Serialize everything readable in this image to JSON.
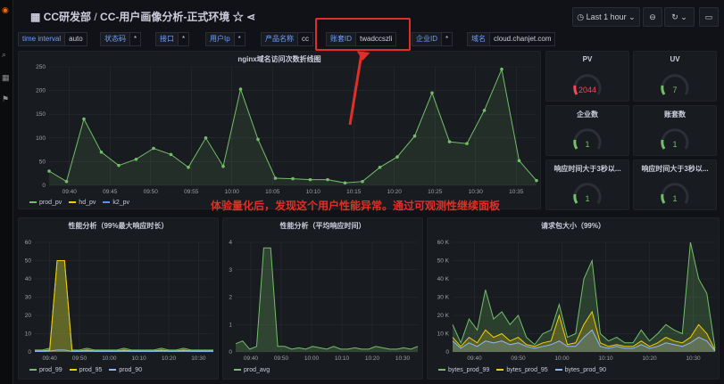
{
  "header": {
    "org": "CC研发部",
    "separator": " / ",
    "title": "CC-用户画像分析-正式环境",
    "star_icon": "star-icon",
    "share_icon": "share-icon",
    "time_range": "Last 1 hour"
  },
  "variables": [
    {
      "label": "time interval",
      "value": "auto"
    },
    {
      "label": "状态码",
      "value": "*"
    },
    {
      "label": "接口",
      "value": "*"
    },
    {
      "label": "用户Ip",
      "value": "*"
    },
    {
      "label": "产品名称",
      "value": "cc"
    },
    {
      "label": "账套ID",
      "value": "twadccszli"
    },
    {
      "label": "企业ID",
      "value": "*"
    },
    {
      "label": "域名",
      "value": "cloud.chanjet.com"
    }
  ],
  "annotation": "体验量化后，发现这个用户性能异常。通过可观测性继续面板",
  "colors": {
    "green": "#73bf69",
    "yellow": "#f2cc0c",
    "blue": "#5794f2",
    "cyan": "#8ab8ff",
    "red": "#f2495c",
    "accent": "#e02f27"
  },
  "stats": [
    {
      "title": "PV",
      "value": "2044",
      "color": "#f2495c"
    },
    {
      "title": "UV",
      "value": "7",
      "color": "#73bf69"
    },
    {
      "title": "企业数",
      "value": "1",
      "color": "#73bf69"
    },
    {
      "title": "账套数",
      "value": "1",
      "color": "#73bf69"
    },
    {
      "title": "响应时间大于3秒以...",
      "value": "1",
      "color": "#73bf69"
    },
    {
      "title": "响应时间大于3秒以...",
      "value": "1",
      "color": "#73bf69"
    }
  ],
  "chart_data": [
    {
      "type": "line",
      "title": "nginx域名访问次数折线图",
      "ylim": [
        0,
        250
      ],
      "yticks": [
        "0",
        "50",
        "100",
        "150",
        "200",
        "250"
      ],
      "x_ticks": [
        "09:40",
        "09:45",
        "09:50",
        "09:55",
        "10:00",
        "10:05",
        "10:10",
        "10:15",
        "10:20",
        "10:25",
        "10:30",
        "10:35"
      ],
      "series": [
        {
          "name": "prod_pv",
          "color": "#73bf69",
          "values": [
            30,
            8,
            140,
            70,
            42,
            55,
            78,
            65,
            38,
            100,
            40,
            203,
            97,
            15,
            14,
            12,
            12,
            5,
            8,
            38,
            60,
            104,
            195,
            92,
            88,
            158,
            245,
            52,
            10
          ]
        },
        {
          "name": "hd_pv",
          "color": "#f2cc0c",
          "values": []
        },
        {
          "name": "k2_pv",
          "color": "#5794f2",
          "values": []
        }
      ]
    },
    {
      "type": "line",
      "title": "性能分析（99%最大响应时长）",
      "ylim": [
        0,
        60
      ],
      "yticks": [
        "0",
        "10",
        "20",
        "30",
        "40",
        "50",
        "60"
      ],
      "x_ticks": [
        "09:40",
        "09:50",
        "10:00",
        "10:10",
        "10:20",
        "10:30"
      ],
      "series": [
        {
          "name": "prod_99",
          "color": "#73bf69",
          "values": [
            1,
            1,
            2,
            50,
            50,
            1,
            1,
            2,
            1,
            1,
            1,
            1,
            2,
            1,
            1,
            1,
            1,
            2,
            1,
            1,
            2,
            1,
            1,
            1,
            1
          ]
        },
        {
          "name": "prod_95",
          "color": "#f2cc0c",
          "values": [
            0.5,
            0.5,
            1,
            50,
            50,
            0.5,
            0.5,
            1,
            0.5,
            0.5,
            0.5,
            0.5,
            1,
            0.5,
            0.5,
            0.5,
            0.5,
            1,
            0.5,
            0.5,
            1,
            0.5,
            0.5,
            0.5,
            0.5
          ]
        },
        {
          "name": "prod_90",
          "color": "#8ab8ff",
          "values": [
            0.3,
            0.3,
            0.5,
            1,
            1,
            0.3,
            0.3,
            0.5,
            0.3,
            0.3,
            0.3,
            0.3,
            0.5,
            0.3,
            0.3,
            0.3,
            0.3,
            0.5,
            0.3,
            0.3,
            0.5,
            0.3,
            0.3,
            0.3,
            0.3
          ]
        }
      ]
    },
    {
      "type": "line",
      "title": "性能分析（平均响应时间）",
      "ylim": [
        0,
        4
      ],
      "yticks": [
        "0",
        "1",
        "2",
        "3",
        "4"
      ],
      "x_ticks": [
        "09:40",
        "09:50",
        "10:00",
        "10:10",
        "10:20",
        "10:30"
      ],
      "series": [
        {
          "name": "prod_avg",
          "color": "#73bf69",
          "values": [
            0.3,
            0.4,
            0.1,
            0.2,
            3.8,
            3.8,
            0.2,
            0.2,
            0.1,
            0.15,
            0.1,
            0.2,
            0.15,
            0.1,
            0.2,
            0.1,
            0.1,
            0.15,
            0.1,
            0.1,
            0.2,
            0.15,
            0.1,
            0.1,
            0.15,
            0.1,
            0.2
          ]
        }
      ]
    },
    {
      "type": "line",
      "title": "请求包大小（99%）",
      "ylim": [
        0,
        60000
      ],
      "yticks": [
        "0",
        "10 K",
        "20 K",
        "30 K",
        "40 K",
        "50 K",
        "60 K"
      ],
      "x_ticks": [
        "09:40",
        "09:50",
        "10:00",
        "10:10",
        "10:20",
        "10:30"
      ],
      "series": [
        {
          "name": "bytes_prod_99",
          "color": "#73bf69",
          "values": [
            15000,
            5000,
            18000,
            12000,
            34000,
            18000,
            22000,
            15000,
            20000,
            8000,
            4000,
            10000,
            12000,
            26000,
            8000,
            10000,
            40000,
            50000,
            10000,
            6000,
            8000,
            5000,
            5000,
            12000,
            6000,
            10000,
            15000,
            12000,
            10000,
            60000,
            40000,
            32000,
            2000
          ]
        },
        {
          "name": "bytes_prod_95",
          "color": "#f2cc0c",
          "values": [
            8000,
            3000,
            8000,
            5000,
            12000,
            8000,
            10000,
            6000,
            8000,
            4000,
            3000,
            5000,
            6000,
            20000,
            4000,
            5000,
            15000,
            22000,
            5000,
            3000,
            4000,
            3000,
            3000,
            6000,
            3000,
            5000,
            8000,
            6000,
            5000,
            8000,
            15000,
            10000,
            1000
          ]
        },
        {
          "name": "bytes_prod_90",
          "color": "#8ab8ff",
          "values": [
            6000,
            2000,
            5000,
            3000,
            6000,
            5000,
            6000,
            4000,
            5000,
            3000,
            2000,
            3000,
            4000,
            6000,
            3000,
            3000,
            8000,
            12000,
            3000,
            2000,
            3000,
            2000,
            2000,
            4000,
            2000,
            3000,
            5000,
            4000,
            3000,
            5000,
            8000,
            6000,
            500
          ]
        }
      ]
    }
  ]
}
